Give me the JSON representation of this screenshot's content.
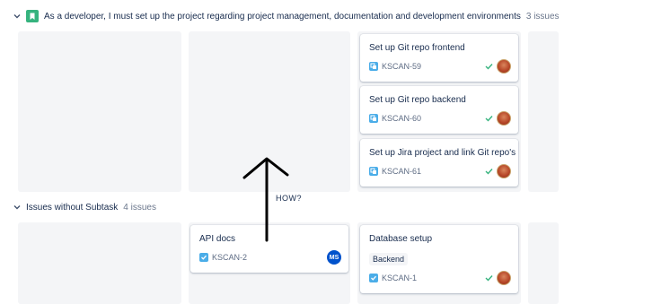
{
  "swimlanes": [
    {
      "title": "As a developer, I must set up the project regarding project management, documentation and development environments",
      "count": "3 issues",
      "cards": [
        {
          "title": "Set up Git repo frontend",
          "key": "KSCAN-59"
        },
        {
          "title": "Set up Git repo backend",
          "key": "KSCAN-60"
        },
        {
          "title": "Set up Jira project and link Git repo's",
          "key": "KSCAN-61"
        }
      ]
    },
    {
      "title": "Issues without Subtask",
      "count": "4 issues",
      "cards": [
        {
          "title": "API docs",
          "key": "KSCAN-2",
          "assignee_initials": "MS"
        },
        {
          "title": "Database setup",
          "key": "KSCAN-1",
          "label": "Backend"
        }
      ]
    }
  ],
  "annotation": {
    "text": "HOW?"
  },
  "colors": {
    "story_green": "#36b37e",
    "subtask_blue": "#4bade8",
    "task_blue": "#4bade8",
    "done_green": "#36b37e",
    "avatar_blue": "#0052cc"
  },
  "icons": [
    "chevron-down-icon",
    "story-icon",
    "subtask-icon",
    "task-icon",
    "done-check-icon",
    "avatar-icon"
  ]
}
